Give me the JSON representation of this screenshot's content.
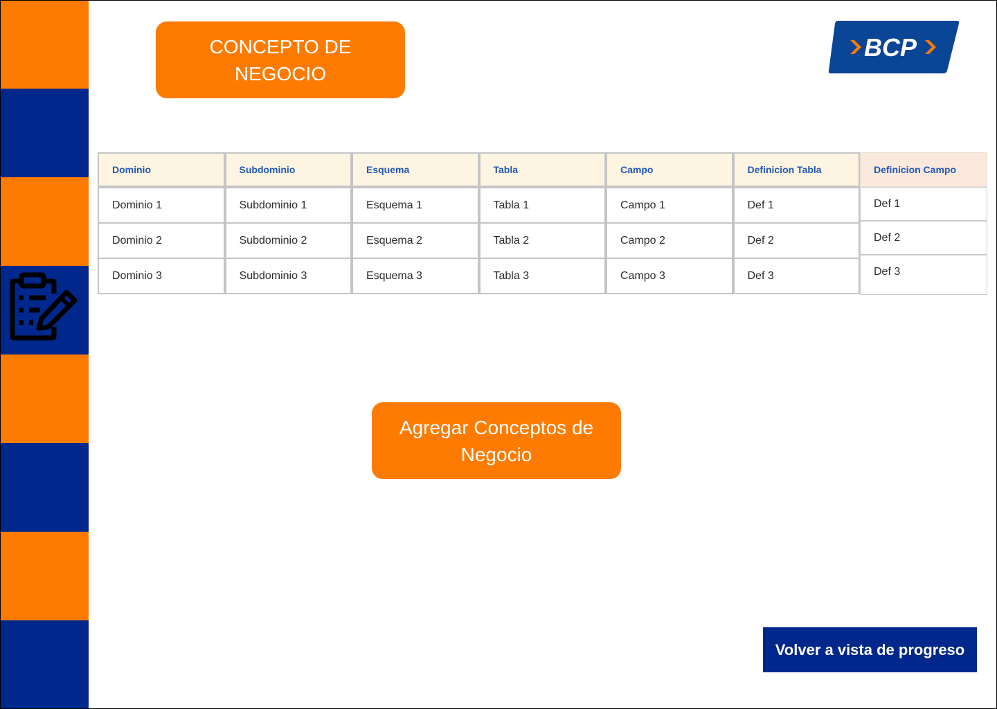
{
  "colors": {
    "orange": "#ff7b00",
    "navy": "#00288c",
    "header_bg": "#fdf5e2",
    "header_bg_alt": "#fbe9dd",
    "header_text": "#1f56b8",
    "logo_blue": "#0a4596",
    "logo_orange": "#ff7b00"
  },
  "sidebar": {
    "stripes": [
      "orange",
      "navy",
      "orange",
      "navy",
      "orange",
      "navy",
      "orange",
      "navy"
    ],
    "icon": "clipboard-edit-icon"
  },
  "header": {
    "title": "CONCEPTO DE NEGOCIO",
    "logo_text": "BCP",
    "logo_icon": "bcp-logo"
  },
  "table": {
    "columns": [
      "Dominio",
      "Subdominio",
      "Esquema",
      "Tabla",
      "Campo",
      "Definicion Tabla",
      "Definicion Campo"
    ],
    "rows": [
      [
        "Dominio 1",
        "Subdominio 1",
        "Esquema 1",
        "Tabla 1",
        "Campo 1",
        "Def 1",
        "Def 1"
      ],
      [
        "Dominio 2",
        "Subdominio 2",
        "Esquema 2",
        "Tabla 2",
        "Campo 2",
        "Def 2",
        "Def 2"
      ],
      [
        "Dominio 3",
        "Subdominio 3",
        "Esquema 3",
        "Tabla 3",
        "Campo 3",
        "Def 3",
        "Def 3"
      ]
    ]
  },
  "actions": {
    "add_label": "Agregar Conceptos de Negocio",
    "back_label": "Volver a vista de progreso"
  }
}
